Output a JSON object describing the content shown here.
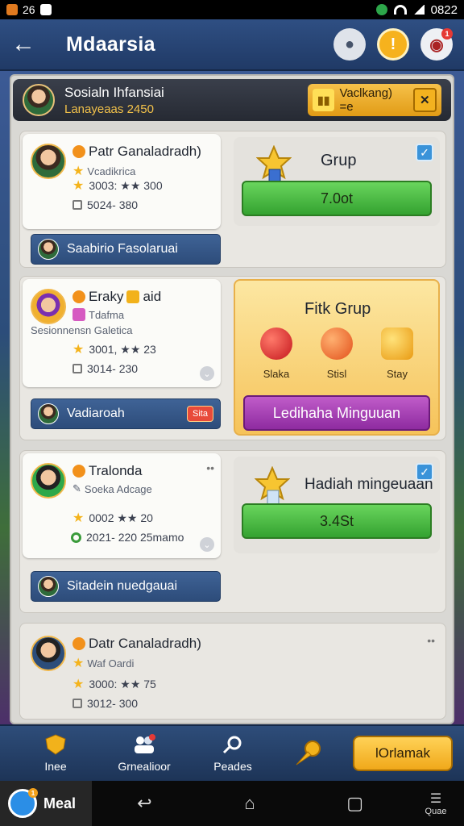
{
  "status_bar": {
    "time": "26",
    "battery": "0822"
  },
  "top_bar": {
    "title": "Mdaarsia",
    "back_icon": "arrow-left-icon",
    "icons": [
      "profile-icon",
      "coin-icon",
      "gamepad-icon"
    ],
    "gamepad_badge": "1"
  },
  "profile": {
    "name": "Sosialn Ihfansiai",
    "subtitle": "Lanayeaas 2450",
    "button_label": "Vaclkang) =e",
    "close_icon": "close-icon"
  },
  "rows": [
    {
      "name": "Patr Ganaladradh)",
      "subtitle": "Vcadikrica",
      "stat1": "3003: ★★ 300",
      "stat2": "5024- 380",
      "name_bar": "Saabirio Fasolaruai",
      "reward": {
        "title": "Grup",
        "button": "7.0ot",
        "checked": true
      }
    },
    {
      "name": "Eraky",
      "name_suffix": "aid",
      "subtitle": "Tdafma",
      "subtitle2": "Sesionnensn Galetica",
      "stat1": "3001, ★★ 23",
      "stat2": "3014- 230",
      "name_bar": "Vadiaroah",
      "name_bar_tag": "Sita",
      "reward": {
        "title": "Fitk Grup",
        "fruits": [
          "Slaka",
          "Stisl",
          "Stay"
        ],
        "button": "Ledihaha Minguuan"
      }
    },
    {
      "name": "Tralonda",
      "subtitle": "Soeka Adcage",
      "stat1": "0002 ★★ 20",
      "stat2": "2021- 220 25mamo",
      "name_bar": "Sitadein nuedgauai",
      "reward": {
        "title": "Hadiah mingeuaan",
        "button": "3.4St",
        "checked": true
      }
    },
    {
      "name": "Datr Canaladradh)",
      "subtitle": "Waf Oardi",
      "stat1": "3000: ★★ 75",
      "stat2": "3012- 300"
    }
  ],
  "bottom_nav": {
    "items": [
      {
        "label": "Inee",
        "icon": "shield-icon"
      },
      {
        "label": "Grnealioor",
        "icon": "group-icon"
      },
      {
        "label": "Peades",
        "icon": "search-icon"
      }
    ],
    "pin_icon": "pin-icon",
    "cta_label": "lOrlamak"
  },
  "system_nav": {
    "app_label": "Meal",
    "more_label": "Quae"
  }
}
